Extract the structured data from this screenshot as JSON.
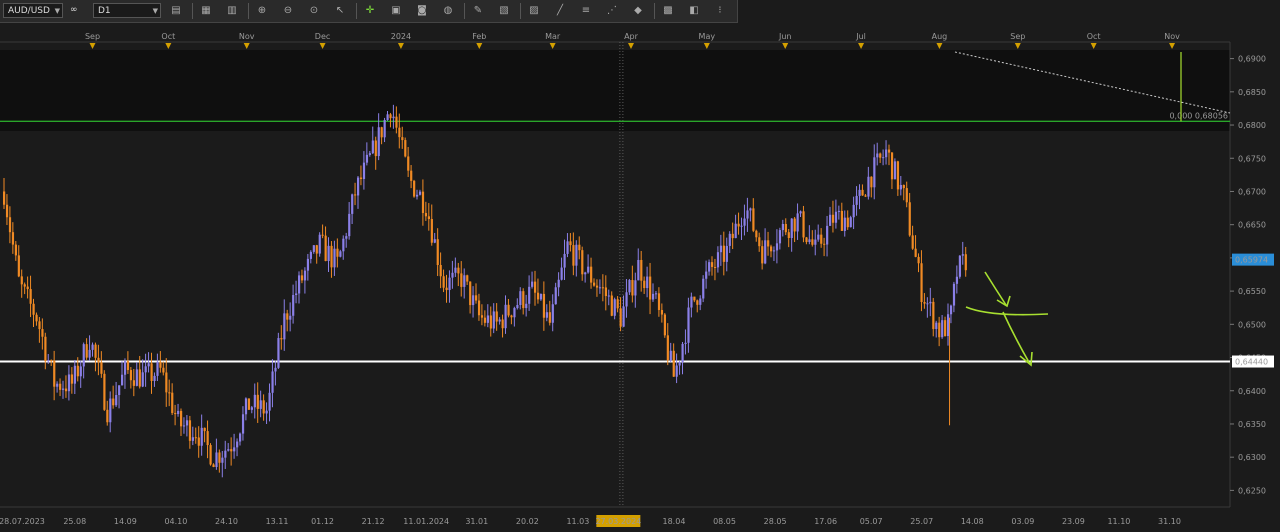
{
  "toolbar": {
    "symbol": "AUD/USD",
    "link_label": "∞",
    "timeframe": "D1",
    "icons": [
      "bar-chart-icon",
      "layout-icon",
      "candles-icon",
      "zoom-in-icon",
      "zoom-out-icon",
      "zoom-fit-icon",
      "cursor-icon",
      "crosshair-icon",
      "save-icon",
      "camera-icon",
      "globe-icon",
      "pencil-icon",
      "template-icon",
      "indicator-icon",
      "lines-icon",
      "channel-icon",
      "fibonacci-icon",
      "shapes-icon",
      "object-icon",
      "eraser-icon",
      "options-icon"
    ]
  },
  "colors": {
    "background": "#1b1b1b",
    "upper_zone": "#0f0f0f",
    "bull_candle": "#8b80e8",
    "bear_candle": "#f08a24",
    "support_line": "#ffffff",
    "resistance_line": "#2aa52a",
    "annotation": "#a8e030",
    "axis_text": "#9a9a9a",
    "marker": "#d4a000",
    "price_tag_current": "#2a8ed8"
  },
  "chart_data": {
    "type": "candlestick",
    "ylim": [
      0.6225,
      0.6925
    ],
    "y_ticks": [
      "0,6900",
      "0,6850",
      "0,6800",
      "0,6750",
      "0,6700",
      "0,6650",
      "0,6600",
      "0,6550",
      "0,6500",
      "0,6450",
      "0,6400",
      "0,6350",
      "0,6300",
      "0,6250"
    ],
    "x_date_labels": [
      "28.07.2023",
      "25.08",
      "14.09",
      "04.10",
      "24.10",
      "13.11",
      "01.12",
      "21.12",
      "11.01.2024",
      "31.01",
      "20.02",
      "11.03",
      "27.03.2024",
      "18.04",
      "08.05",
      "28.05",
      "17.06",
      "05.07",
      "25.07",
      "14.08",
      "03.09",
      "23.09",
      "11.10",
      "31.10"
    ],
    "highlighted_date": "27.03.2024",
    "month_labels": [
      "Sep",
      "Oct",
      "Nov",
      "Dec",
      "2024",
      "Feb",
      "Mar",
      "Apr",
      "May",
      "Jun",
      "Jul",
      "Aug",
      "Sep",
      "Oct",
      "Nov"
    ],
    "horizontal_lines": [
      {
        "price": 0.68056,
        "color": "#2aa52a",
        "label": "0,000 0,68056"
      },
      {
        "price": 0.6444,
        "color": "#ffffff",
        "label": "0,64440"
      }
    ],
    "current_price": "0,65974",
    "price_path": [
      [
        "2023-07-28",
        0.67
      ],
      [
        "2023-08-03",
        0.656
      ],
      [
        "2023-08-10",
        0.651
      ],
      [
        "2023-08-17",
        0.641
      ],
      [
        "2023-08-24",
        0.641
      ],
      [
        "2023-08-31",
        0.648
      ],
      [
        "2023-09-07",
        0.637
      ],
      [
        "2023-09-14",
        0.643
      ],
      [
        "2023-09-21",
        0.642
      ],
      [
        "2023-09-28",
        0.643
      ],
      [
        "2023-10-05",
        0.635
      ],
      [
        "2023-10-12",
        0.634
      ],
      [
        "2023-10-19",
        0.63
      ],
      [
        "2023-10-26",
        0.632
      ],
      [
        "2023-11-02",
        0.638
      ],
      [
        "2023-11-09",
        0.637
      ],
      [
        "2023-11-16",
        0.651
      ],
      [
        "2023-11-23",
        0.657
      ],
      [
        "2023-11-30",
        0.662
      ],
      [
        "2023-12-07",
        0.659
      ],
      [
        "2023-12-14",
        0.67
      ],
      [
        "2023-12-21",
        0.676
      ],
      [
        "2023-12-28",
        0.683
      ],
      [
        "2024-01-04",
        0.672
      ],
      [
        "2024-01-11",
        0.668
      ],
      [
        "2024-01-18",
        0.656
      ],
      [
        "2024-01-25",
        0.657
      ],
      [
        "2024-02-01",
        0.651
      ],
      [
        "2024-02-08",
        0.65
      ],
      [
        "2024-02-15",
        0.653
      ],
      [
        "2024-02-22",
        0.655
      ],
      [
        "2024-02-29",
        0.65
      ],
      [
        "2024-03-07",
        0.662
      ],
      [
        "2024-03-14",
        0.658
      ],
      [
        "2024-03-21",
        0.655
      ],
      [
        "2024-03-28",
        0.651
      ],
      [
        "2024-04-04",
        0.659
      ],
      [
        "2024-04-11",
        0.653
      ],
      [
        "2024-04-18",
        0.642
      ],
      [
        "2024-04-25",
        0.653
      ],
      [
        "2024-05-02",
        0.658
      ],
      [
        "2024-05-09",
        0.661
      ],
      [
        "2024-05-16",
        0.668
      ],
      [
        "2024-05-23",
        0.661
      ],
      [
        "2024-05-30",
        0.664
      ],
      [
        "2024-06-06",
        0.666
      ],
      [
        "2024-06-13",
        0.661
      ],
      [
        "2024-06-20",
        0.666
      ],
      [
        "2024-06-27",
        0.666
      ],
      [
        "2024-07-04",
        0.672
      ],
      [
        "2024-07-11",
        0.676
      ],
      [
        "2024-07-18",
        0.669
      ],
      [
        "2024-07-25",
        0.655
      ],
      [
        "2024-08-01",
        0.649
      ],
      [
        "2024-08-05",
        0.65
      ],
      [
        "2024-08-08",
        0.658
      ],
      [
        "2024-08-12",
        0.66
      ]
    ]
  }
}
